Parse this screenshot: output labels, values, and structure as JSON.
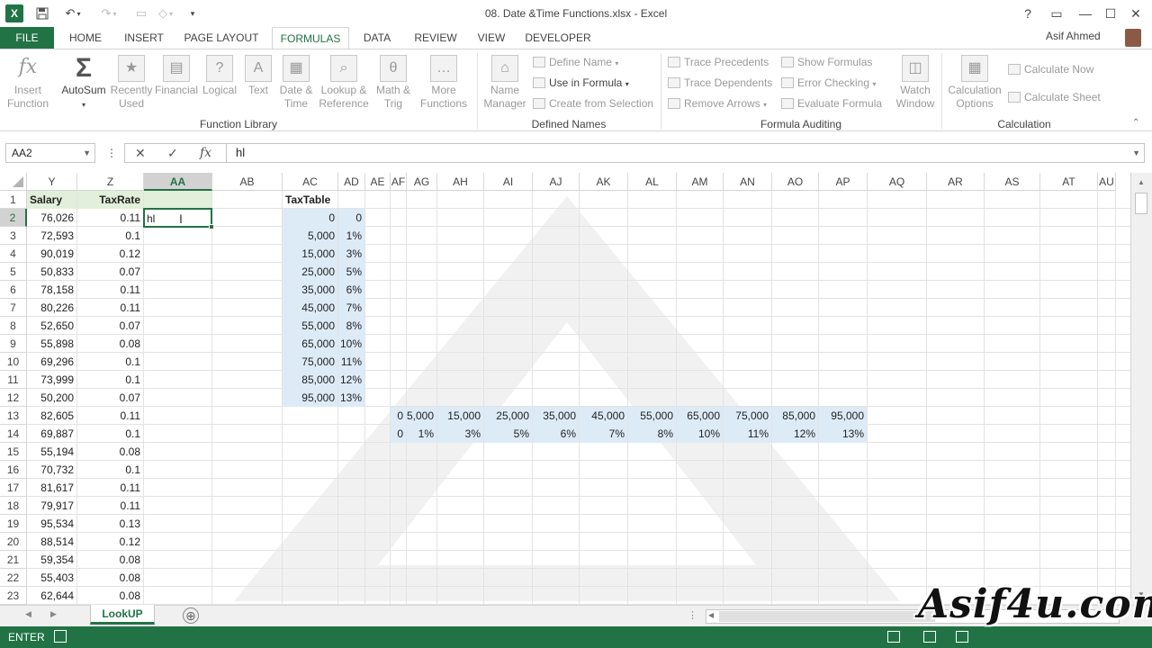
{
  "window": {
    "title": "08. Date &Time Functions.xlsx - Excel",
    "app_icon": "X",
    "user": "Asif Ahmed",
    "help_label": "?"
  },
  "tabs": [
    "FILE",
    "HOME",
    "INSERT",
    "PAGE LAYOUT",
    "FORMULAS",
    "DATA",
    "REVIEW",
    "VIEW",
    "DEVELOPER"
  ],
  "active_tab": "FORMULAS",
  "ribbon": {
    "insert_function": "Insert\nFunction",
    "autosum": "AutoSum",
    "recently_used": "Recently\nUsed",
    "financial": "Financial",
    "logical": "Logical",
    "text": "Text",
    "date_time": "Date &\nTime",
    "lookup_reference": "Lookup &\nReference",
    "math_trig": "Math &\nTrig",
    "more_functions": "More\nFunctions",
    "group_function_library": "Function Library",
    "name_manager": "Name\nManager",
    "define_name": "Define Name",
    "use_in_formula": "Use in Formula",
    "create_from_selection": "Create from Selection",
    "group_defined_names": "Defined Names",
    "trace_precedents": "Trace Precedents",
    "trace_dependents": "Trace Dependents",
    "remove_arrows": "Remove Arrows",
    "show_formulas": "Show Formulas",
    "error_checking": "Error Checking",
    "evaluate_formula": "Evaluate Formula",
    "watch_window": "Watch\nWindow",
    "group_formula_auditing": "Formula Auditing",
    "calculation_options": "Calculation\nOptions",
    "calculate_now": "Calculate Now",
    "calculate_sheet": "Calculate Sheet",
    "group_calculation": "Calculation"
  },
  "formula_bar": {
    "name_box": "AA2",
    "cancel": "✕",
    "enter": "✓",
    "fx": "fx",
    "content": "hl"
  },
  "columns": [
    "Y",
    "Z",
    "AA",
    "AB",
    "AC",
    "AD",
    "AE",
    "AF",
    "AG",
    "AH",
    "AI",
    "AJ",
    "AK",
    "AL",
    "AM",
    "AN",
    "AO",
    "AP",
    "AQ",
    "AR",
    "AS",
    "AT",
    "AU"
  ],
  "selected_column": "AA",
  "rows": [
    "1",
    "2",
    "3",
    "4",
    "5",
    "6",
    "7",
    "8",
    "9",
    "10",
    "11",
    "12",
    "13",
    "14",
    "15",
    "16",
    "17",
    "18",
    "19",
    "20",
    "21",
    "22",
    "23"
  ],
  "selected_row": "2",
  "headers": {
    "salary": "Salary",
    "taxrate": "TaxRate",
    "taxtable": "TaxTable"
  },
  "salary": [
    "76,026",
    "72,593",
    "90,019",
    "50,833",
    "78,158",
    "80,226",
    "52,650",
    "55,898",
    "69,296",
    "73,999",
    "50,200",
    "82,605",
    "69,887",
    "55,194",
    "70,732",
    "81,617",
    "79,917",
    "95,534",
    "88,514",
    "59,354",
    "55,403",
    "62,644"
  ],
  "taxrate": [
    "0.11",
    "0.1",
    "0.12",
    "0.07",
    "0.11",
    "0.11",
    "0.07",
    "0.08",
    "0.1",
    "0.1",
    "0.07",
    "0.11",
    "0.1",
    "0.08",
    "0.1",
    "0.11",
    "0.11",
    "0.13",
    "0.12",
    "0.08",
    "0.08",
    "0.08"
  ],
  "taxtable_thresholds": [
    "0",
    "5,000",
    "15,000",
    "25,000",
    "35,000",
    "45,000",
    "55,000",
    "65,000",
    "75,000",
    "85,000",
    "95,000"
  ],
  "taxtable_rates": [
    "0",
    "1%",
    "3%",
    "5%",
    "6%",
    "7%",
    "8%",
    "10%",
    "11%",
    "12%",
    "13%"
  ],
  "hrow_thresholds": [
    "0",
    "5,000",
    "15,000",
    "25,000",
    "35,000",
    "45,000",
    "55,000",
    "65,000",
    "75,000",
    "85,000",
    "95,000"
  ],
  "hrow_rates": [
    "0",
    "1%",
    "3%",
    "5%",
    "6%",
    "7%",
    "8%",
    "10%",
    "11%",
    "12%",
    "13%"
  ],
  "active_cell_text": "hl",
  "sheet_tab": "LookUP",
  "add_sheet": "⊕",
  "status": {
    "mode": "ENTER"
  },
  "brand": "Asif4u.com",
  "colors": {
    "excel_green": "#217346",
    "header_fill": "#e2efda",
    "table_fill": "#ddebf7"
  }
}
